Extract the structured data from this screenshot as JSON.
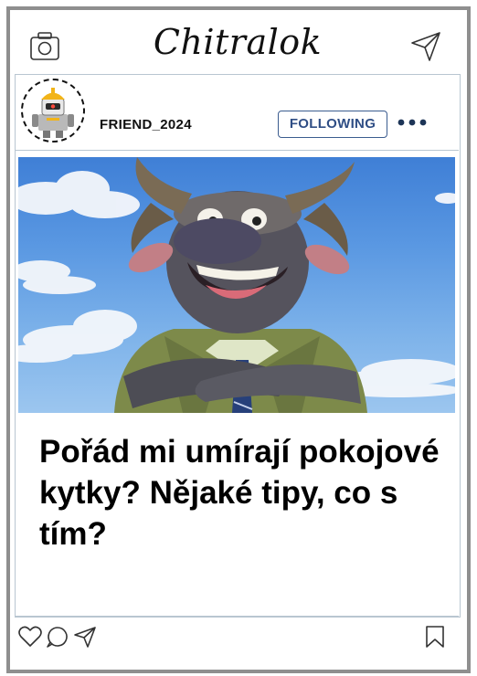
{
  "app": {
    "brand": "Chitralok"
  },
  "post": {
    "username": "FRIEND_2024",
    "follow_label": "FOLLOWING",
    "caption": "Pořád mi umírají pokojové kytky? Nějaké tipy, co s tím?"
  },
  "icons": {
    "camera": "camera-icon",
    "send": "send-icon",
    "more": "more-options-icon",
    "like": "heart-icon",
    "comment": "comment-icon",
    "share": "share-icon",
    "save": "bookmark-icon"
  },
  "colors": {
    "accent": "#2f4e85",
    "frame": "#8f8f8f",
    "divider": "#b9c6d1"
  }
}
